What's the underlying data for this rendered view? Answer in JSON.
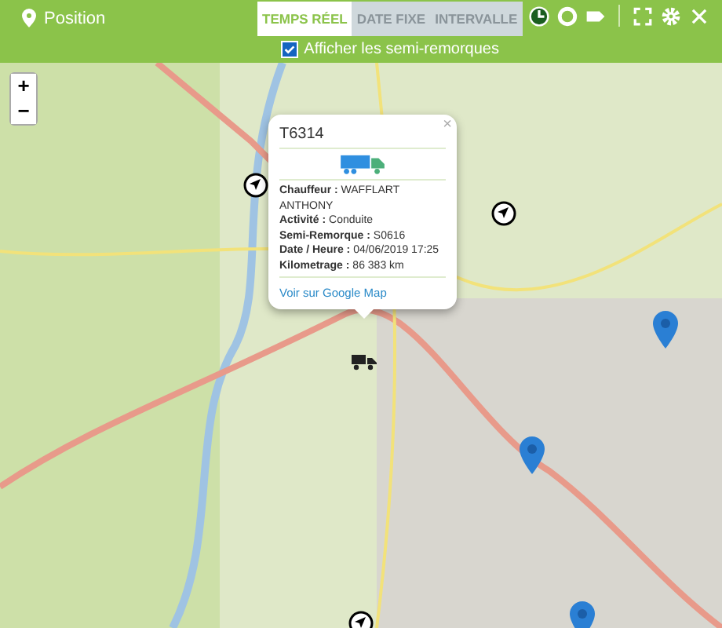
{
  "header": {
    "title": "Position",
    "tabs": [
      {
        "label": "TEMPS RÉEL",
        "selected": true
      },
      {
        "label": "DATE FIXE",
        "selected": false
      },
      {
        "label": "INTERVALLE",
        "selected": false
      }
    ],
    "checkbox": {
      "label": "Afficher les semi-remorques",
      "checked": true
    }
  },
  "map": {
    "zoom_in": "+",
    "zoom_out": "−",
    "markers": [
      {
        "kind": "arrow"
      },
      {
        "kind": "arrow"
      },
      {
        "kind": "arrow"
      },
      {
        "kind": "truck"
      },
      {
        "kind": "pin"
      },
      {
        "kind": "pin"
      },
      {
        "kind": "pin"
      }
    ],
    "popup": {
      "close": "×",
      "title": "T6314",
      "fields": [
        {
          "label": "Chauffeur :",
          "value": "WAFFLART ANTHONY"
        },
        {
          "label": "Activité :",
          "value": "Conduite"
        },
        {
          "label": "Semi-Remorque :",
          "value": "S0616"
        },
        {
          "label": "Date / Heure :",
          "value": "04/06/2019 17:25"
        },
        {
          "label": "Kilometrage :",
          "value": "86 383 km"
        }
      ],
      "link": "Voir sur Google Map"
    }
  }
}
